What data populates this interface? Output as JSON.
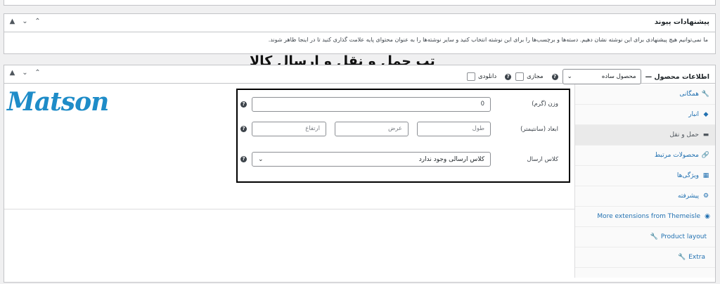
{
  "suggested_links": {
    "title": "پیشنهادات پیوند",
    "description": "ما نمی‌توانیم هیچ پیشنهادی برای این نوشته نشان دهیم. دسته‌ها و برچسب‌ها را برای این نوشته انتخاب کنید و سایر نوشته‌ها را به عنوان محتوای پایه علامت گذاری کنید تا در اینجا ظاهر شوند."
  },
  "annotation": "تب حمل و نقل و ارسال کالا",
  "logo_text": "Matson",
  "product_data": {
    "title": "اطلاعات محصول —",
    "type_select": "محصول ساده",
    "virtual_label": "مجازی",
    "downloadable_label": "دانلودی"
  },
  "tabs": [
    {
      "label": "همگانی",
      "icon": "wrench-icon",
      "glyph": "🔧"
    },
    {
      "label": "انبار",
      "icon": "tag-icon",
      "glyph": "◆"
    },
    {
      "label": "حمل و نقل",
      "icon": "truck-icon",
      "glyph": "▬"
    },
    {
      "label": "محصولات مرتبط",
      "icon": "link-icon",
      "glyph": "🔗"
    },
    {
      "label": "ویژگی‌ها",
      "icon": "table-icon",
      "glyph": "▦"
    },
    {
      "label": "پیشرفته",
      "icon": "gear-icon",
      "glyph": "⚙"
    },
    {
      "label": "More extensions from Themeisle",
      "icon": "plugin-icon",
      "glyph": "◉"
    },
    {
      "label": "Product layout",
      "icon": "wrench-icon",
      "glyph": "🔧"
    },
    {
      "label": "Extra",
      "icon": "wrench-icon",
      "glyph": "🔧"
    }
  ],
  "shipping": {
    "weight_label": "وزن (گرم)",
    "weight_value": "0",
    "dimensions_label": "ابعاد (سانتیمتر)",
    "length_placeholder": "طول",
    "width_placeholder": "عرض",
    "height_placeholder": "ارتفاع",
    "class_label": "کلاس ارسال",
    "class_value": "کلاس ارسالی وجود ندارد"
  },
  "controls": {
    "up": "▲",
    "down": "⌄",
    "collapse": "^"
  }
}
